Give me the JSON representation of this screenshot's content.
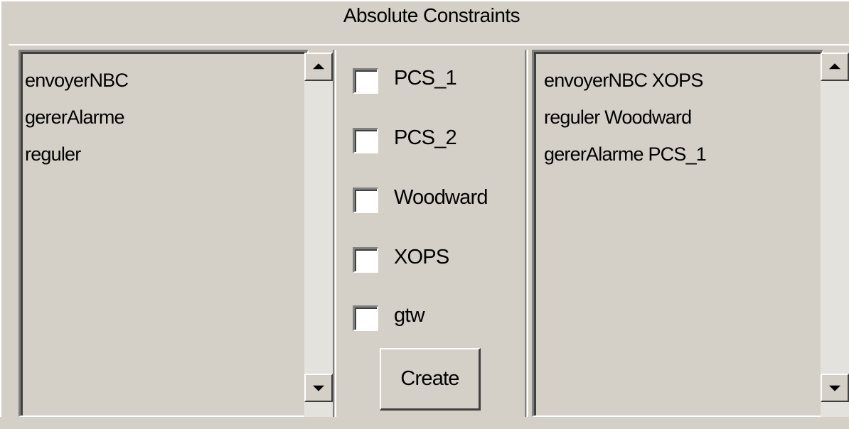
{
  "panel": {
    "title": "Absolute Constraints"
  },
  "left_list": {
    "items": [
      "envoyerNBC",
      "gererAlarme",
      "reguler"
    ]
  },
  "checkboxes": [
    {
      "label": "PCS_1",
      "checked": false
    },
    {
      "label": "PCS_2",
      "checked": false
    },
    {
      "label": "Woodward",
      "checked": false
    },
    {
      "label": "XOPS",
      "checked": false
    },
    {
      "label": "gtw",
      "checked": false
    }
  ],
  "create_button": {
    "label": "Create"
  },
  "right_list": {
    "items": [
      "envoyerNBC XOPS",
      "reguler Woodward",
      "gererAlarme PCS_1"
    ]
  }
}
